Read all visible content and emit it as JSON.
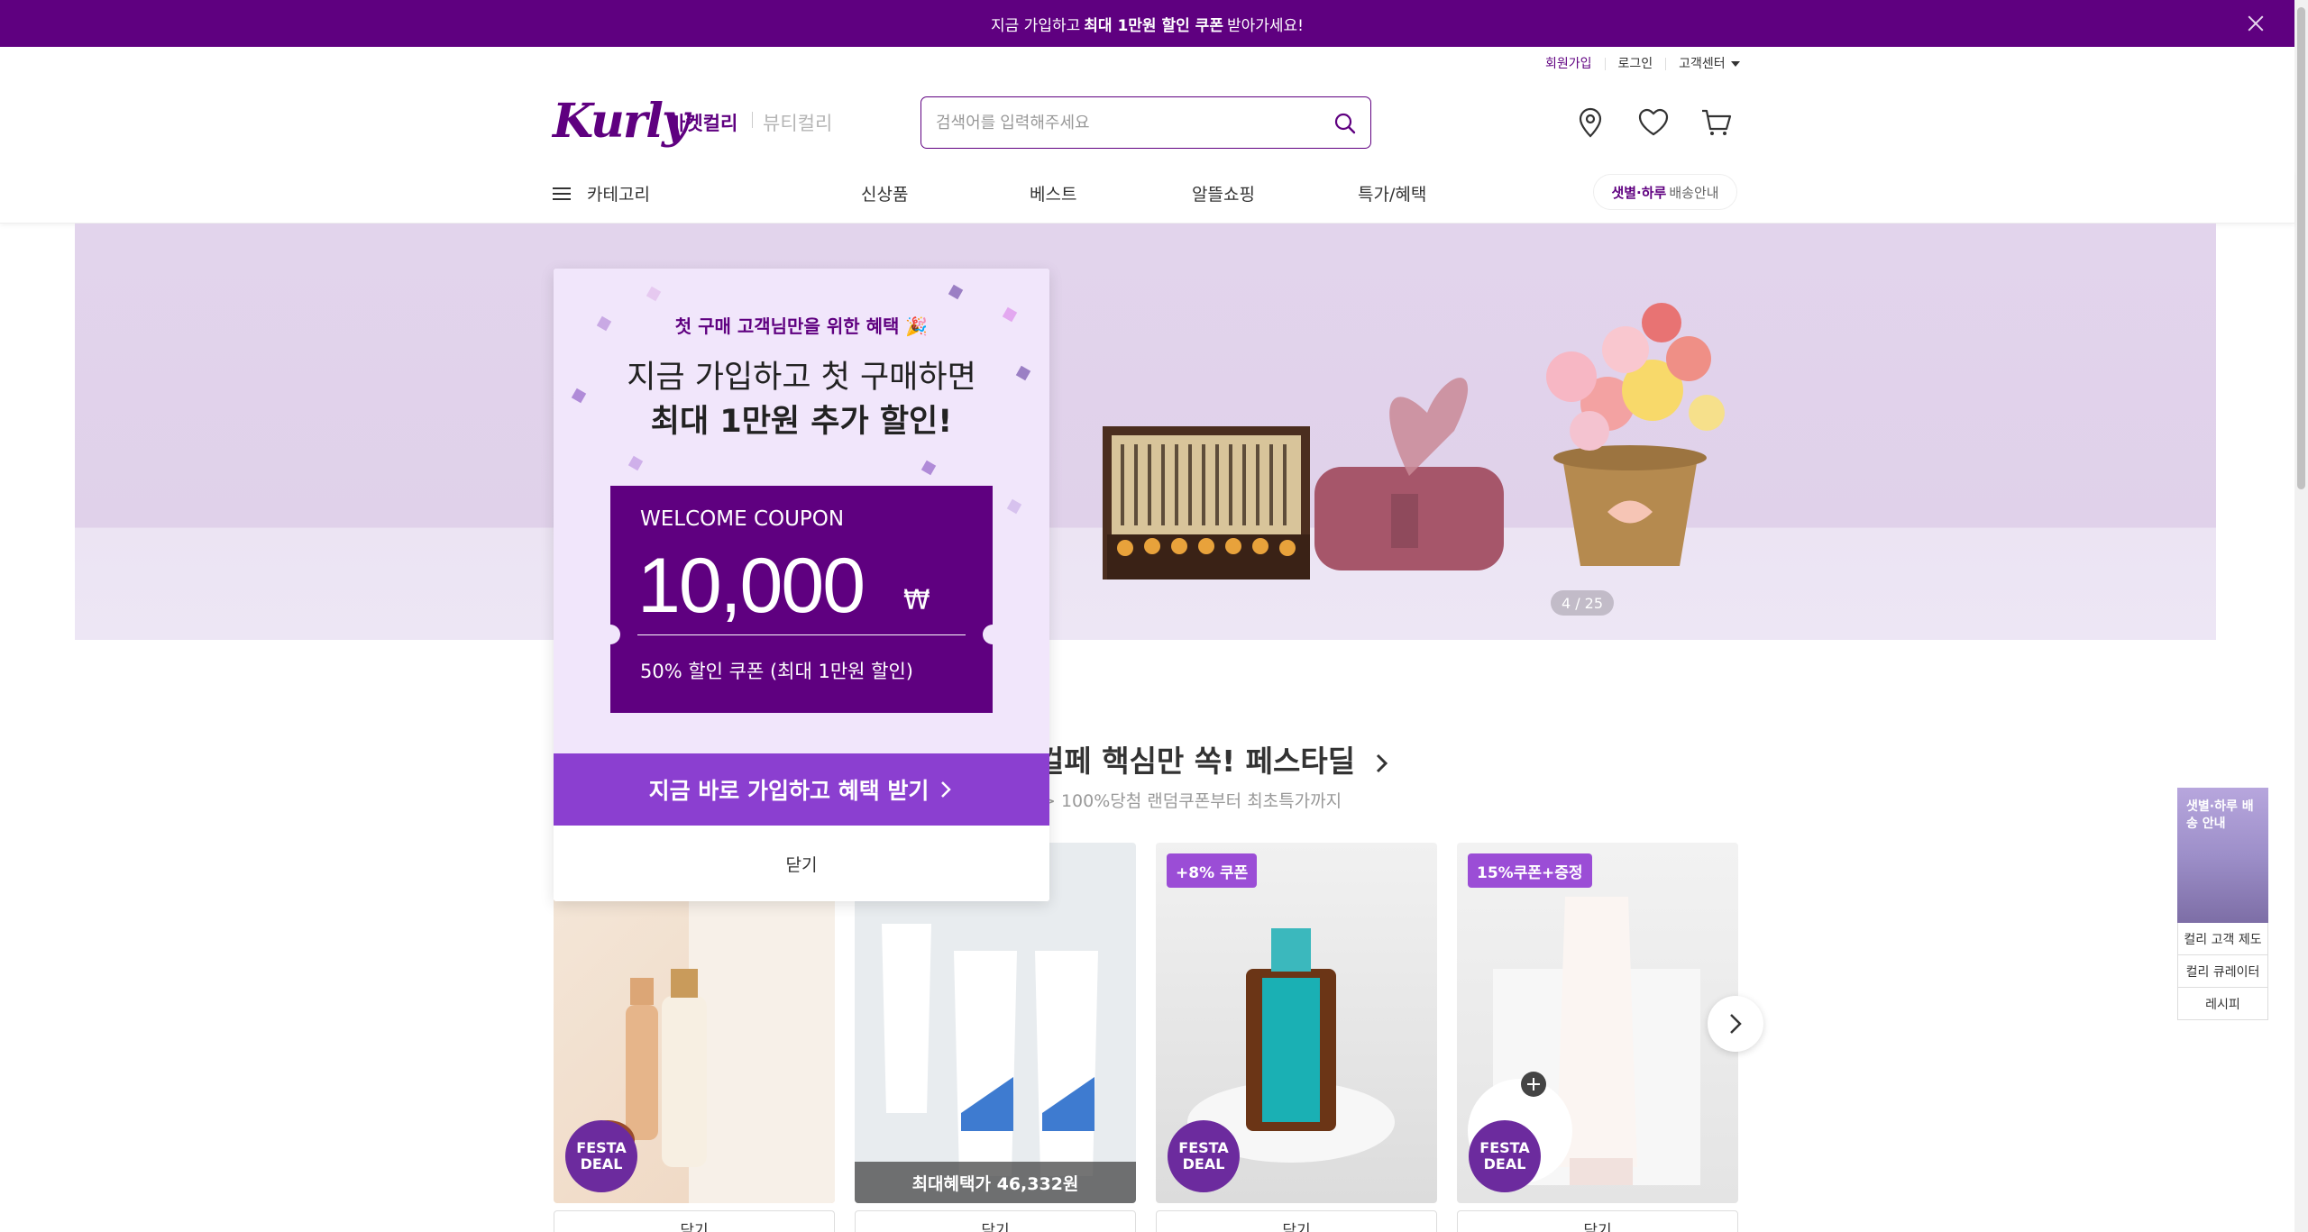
{
  "promo": {
    "text_before": "지금 가입하고",
    "text_bold": "최대 1만원 할인 쿠폰",
    "text_after": "받아가세요!"
  },
  "util": {
    "signup": "회원가입",
    "login": "로그인",
    "support": "고객센터"
  },
  "header": {
    "logo": "Kurly",
    "tab_market": "마켓컬리",
    "tab_beauty": "뷰티컬리",
    "search_placeholder": "검색어를 입력해주세요"
  },
  "nav": {
    "category": "카테고리",
    "items": [
      "신상품",
      "베스트",
      "알뜰쇼핑",
      "특가/혜택"
    ],
    "delivery_bold": "샛별·하루",
    "delivery_rest": "배송안내"
  },
  "banner": {
    "counter": "4 / 25"
  },
  "section": {
    "title": "컬페 핵심만 쏙! 페스타딜",
    "subtitle": "> 100%당첨 랜덤쿠폰부터 최초특가까지"
  },
  "products": [
    {
      "badge": "",
      "festa": "FESTA DEAL",
      "benefit": "",
      "cart": "담기"
    },
    {
      "badge": "",
      "festa": "",
      "benefit": "최대혜택가 46,332원",
      "cart": "담기"
    },
    {
      "badge": "+8% 쿠폰",
      "festa": "FESTA DEAL",
      "benefit": "",
      "cart": "담기"
    },
    {
      "badge": "15%쿠폰+증정",
      "festa": "FESTA DEAL",
      "benefit": "",
      "cart": "담기"
    }
  ],
  "side": {
    "banner_text": "샛별·하루 배송 안내",
    "links": [
      "컬리 고객 제도",
      "컬리 큐레이터",
      "레시피"
    ]
  },
  "modal": {
    "sub": "첫 구매 고객님만을 위한 혜택 🎉",
    "headline1": "지금 가입하고 첫 구매하면",
    "headline2": "최대 1만원 추가 할인!",
    "coupon_label": "WELCOME COUPON",
    "coupon_amount": "10,000",
    "coupon_unit": "₩",
    "coupon_desc": "50% 할인 쿠폰 (최대 1만원 할인)",
    "cta": "지금 바로 가입하고 혜택 받기",
    "close": "닫기"
  },
  "colors": {
    "brand": "#5f0080",
    "cta": "#8b3fd0",
    "badge": "#9b4dd6"
  }
}
